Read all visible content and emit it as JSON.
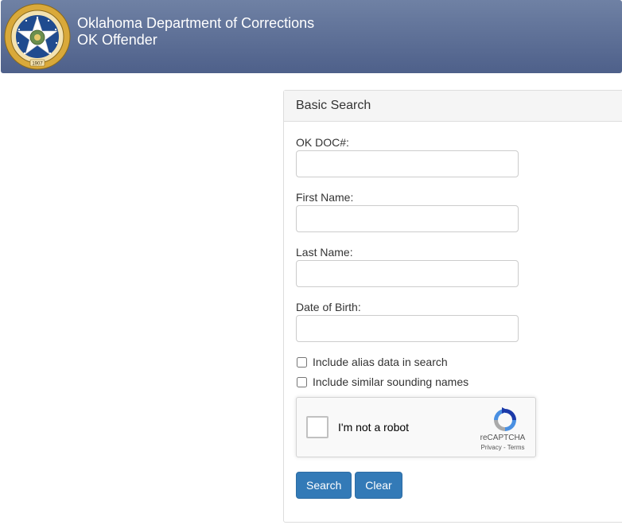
{
  "header": {
    "title": "Oklahoma Department of Corrections",
    "subtitle": "OK Offender",
    "seal": {
      "label": "GREAT SEAL OF THE STATE OF OKLAHOMA",
      "year": "1907"
    }
  },
  "search": {
    "heading": "Basic Search",
    "fields": {
      "doc": {
        "label": "OK DOC#:",
        "value": ""
      },
      "first_name": {
        "label": "First Name:",
        "value": ""
      },
      "last_name": {
        "label": "Last Name:",
        "value": ""
      },
      "dob": {
        "label": "Date of Birth:",
        "value": ""
      }
    },
    "options": {
      "alias": {
        "label": "Include alias data in search",
        "checked": false
      },
      "similar": {
        "label": "Include similar sounding names",
        "checked": false
      }
    },
    "recaptcha": {
      "label": "I'm not a robot",
      "brand": "reCAPTCHA",
      "links": "Privacy - Terms"
    },
    "buttons": {
      "search": "Search",
      "clear": "Clear"
    }
  },
  "colors": {
    "header_top": "#6f81a4",
    "header_bottom": "#4e608a",
    "primary_button": "#337ab7",
    "seal_gold": "#d9a93a",
    "seal_blue": "#1f4b8f"
  }
}
